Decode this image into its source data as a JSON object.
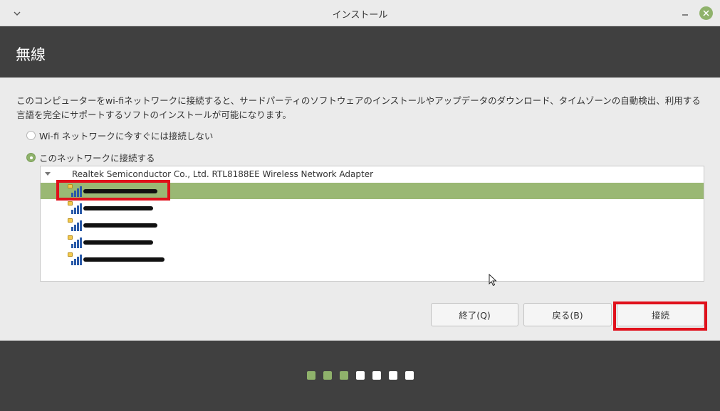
{
  "window": {
    "title": "インストール",
    "accent_color": "#8fb26b"
  },
  "header": {
    "title": "無線"
  },
  "description": "このコンピューターをwi-fiネットワークに接続すると、サードパーティのソフトウェアのインストールやアップデータのダウンロード、タイムゾーンの自動検出、利用する言語を完全にサポートするソフトのインストールが可能になります。",
  "options": [
    {
      "label": "Wi-fi ネットワークに今すぐには接続しない",
      "checked": false
    },
    {
      "label": "このネットワークに接続する",
      "checked": true
    }
  ],
  "networks": {
    "adapter": "Realtek Semiconductor Co., Ltd. RTL8188EE Wireless Network Adapter",
    "items": [
      {
        "icon": "wifi-secured-icon",
        "selected": true,
        "ssid_redacted": true
      },
      {
        "icon": "wifi-secured-icon",
        "selected": false,
        "ssid_redacted": true
      },
      {
        "icon": "wifi-secured-icon",
        "selected": false,
        "ssid_redacted": true
      },
      {
        "icon": "wifi-secured-icon",
        "selected": false,
        "ssid_redacted": true
      },
      {
        "icon": "wifi-secured-icon",
        "selected": false,
        "ssid_redacted": true
      }
    ]
  },
  "buttons": {
    "quit": "終了(Q)",
    "back": "戻る(B)",
    "connect": "接続"
  },
  "progress": {
    "total_steps": 7,
    "completed_steps": 3
  },
  "annotations": {
    "highlight_color": "#e0101b"
  }
}
